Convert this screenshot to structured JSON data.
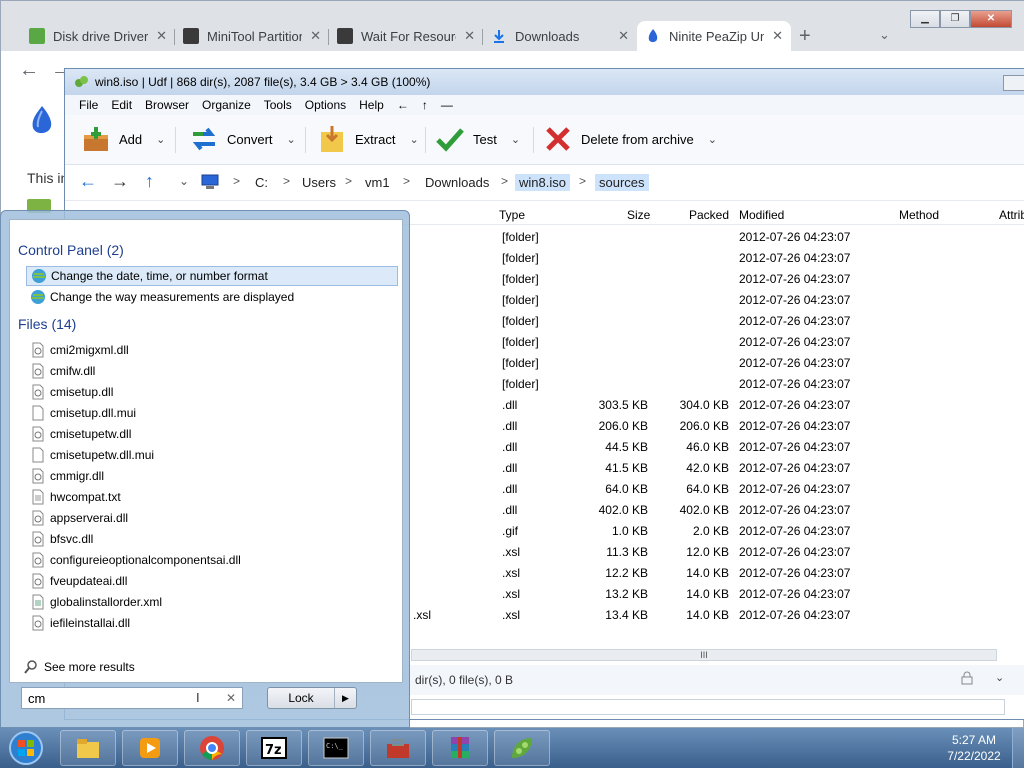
{
  "chrome": {
    "tabs": [
      {
        "title": "Disk drive Driver",
        "icon_color": "#5aa845"
      },
      {
        "title": "MiniTool Partition",
        "icon_color": "#3a3a3a"
      },
      {
        "title": "Wait For Resourc",
        "icon_color": "#3a3a3a"
      },
      {
        "title": "Downloads",
        "icon_color": "#1a73e8"
      },
      {
        "title": "Ninite PeaZip Un",
        "icon_color": "#2b66d9"
      }
    ],
    "new_tab": "+",
    "tab_menu": "⌄",
    "back": "←",
    "forward": "→",
    "page_text": "This in"
  },
  "peazip": {
    "title": "win8.iso | Udf | 868 dir(s), 2087 file(s), 3.4 GB > 3.4 GB (100%)",
    "menu": [
      "File",
      "Edit",
      "Browser",
      "Organize",
      "Tools",
      "Options",
      "Help",
      "←",
      "↑",
      "—"
    ],
    "toolbar": {
      "add": "Add",
      "convert": "Convert",
      "extract": "Extract",
      "test": "Test",
      "delete": "Delete from archive",
      "dropdown": "⌄"
    },
    "path": {
      "back": "←",
      "forward": "→",
      "up": "↑",
      "dropdown": "⌄",
      "sep": ">",
      "crumbs": [
        "C:",
        "Users",
        "vm1",
        "Downloads",
        "win8.iso",
        "sources"
      ]
    },
    "columns": {
      "type": "Type",
      "size": "Size",
      "packed": "Packed",
      "modified": "Modified",
      "method": "Method",
      "attrib": "Attrib"
    },
    "rows": [
      {
        "name": "",
        "type": "[folder]",
        "size": "",
        "packed": "",
        "modified": "2012-07-26 04:23:07"
      },
      {
        "name": "",
        "type": "[folder]",
        "size": "",
        "packed": "",
        "modified": "2012-07-26 04:23:07"
      },
      {
        "name": "",
        "type": "[folder]",
        "size": "",
        "packed": "",
        "modified": "2012-07-26 04:23:07"
      },
      {
        "name": "",
        "type": "[folder]",
        "size": "",
        "packed": "",
        "modified": "2012-07-26 04:23:07"
      },
      {
        "name": "",
        "type": "[folder]",
        "size": "",
        "packed": "",
        "modified": "2012-07-26 04:23:07"
      },
      {
        "name": "",
        "type": "[folder]",
        "size": "",
        "packed": "",
        "modified": "2012-07-26 04:23:07"
      },
      {
        "name": "",
        "type": "[folder]",
        "size": "",
        "packed": "",
        "modified": "2012-07-26 04:23:07"
      },
      {
        "name": "",
        "type": "[folder]",
        "size": "",
        "packed": "",
        "modified": "2012-07-26 04:23:07"
      },
      {
        "name": "",
        "type": ".dll",
        "size": "303.5 KB",
        "packed": "304.0 KB",
        "modified": "2012-07-26 04:23:07"
      },
      {
        "name": "",
        "type": ".dll",
        "size": "206.0 KB",
        "packed": "206.0 KB",
        "modified": "2012-07-26 04:23:07"
      },
      {
        "name": "",
        "type": ".dll",
        "size": "44.5 KB",
        "packed": "46.0 KB",
        "modified": "2012-07-26 04:23:07"
      },
      {
        "name": "",
        "type": ".dll",
        "size": "41.5 KB",
        "packed": "42.0 KB",
        "modified": "2012-07-26 04:23:07"
      },
      {
        "name": "",
        "type": ".dll",
        "size": "64.0 KB",
        "packed": "64.0 KB",
        "modified": "2012-07-26 04:23:07"
      },
      {
        "name": "",
        "type": ".dll",
        "size": "402.0 KB",
        "packed": "402.0 KB",
        "modified": "2012-07-26 04:23:07"
      },
      {
        "name": "",
        "type": ".gif",
        "size": "1.0 KB",
        "packed": "2.0 KB",
        "modified": "2012-07-26 04:23:07"
      },
      {
        "name": "",
        "type": ".xsl",
        "size": "11.3 KB",
        "packed": "12.0 KB",
        "modified": "2012-07-26 04:23:07"
      },
      {
        "name": "",
        "type": ".xsl",
        "size": "12.2 KB",
        "packed": "14.0 KB",
        "modified": "2012-07-26 04:23:07"
      },
      {
        "name": "",
        "type": ".xsl",
        "size": "13.2 KB",
        "packed": "14.0 KB",
        "modified": "2012-07-26 04:23:07"
      },
      {
        "name": ".xsl",
        "type": ".xsl",
        "size": "13.4 KB",
        "packed": "14.0 KB",
        "modified": "2012-07-26 04:23:07"
      }
    ],
    "scroll_grip": "III",
    "status": "dir(s), 0 file(s), 0 B",
    "status_chevron": "⌄"
  },
  "startmenu": {
    "cp_header": "Control Panel (2)",
    "cp_items": [
      "Change the date, time, or number format",
      "Change the way measurements are displayed"
    ],
    "files_header": "Files (14)",
    "files": [
      "cmi2migxml.dll",
      "cmifw.dll",
      "cmisetup.dll",
      "cmisetup.dll.mui",
      "cmisetupetw.dll",
      "cmisetupetw.dll.mui",
      "cmmigr.dll",
      "hwcompat.txt",
      "appserverai.dll",
      "bfsvc.dll",
      "configureieoptionalcomponentsai.dll",
      "fveupdateai.dll",
      "globalinstallorder.xml",
      "iefileinstallai.dll"
    ],
    "see_more": "See more results",
    "search_value": "cm",
    "clear": "✕",
    "caret": "I",
    "lock_label": "Lock",
    "lock_arrow": "▶"
  },
  "taskbar": {
    "time": "5:27 AM",
    "date": "7/22/2022"
  }
}
